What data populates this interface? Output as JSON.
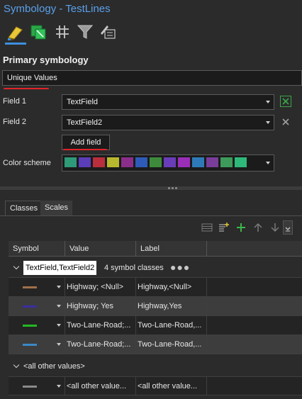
{
  "window": {
    "title": "Symbology - TestLines"
  },
  "toolbar": {
    "icons": [
      "primary-symbology-icon",
      "vary-symbology-icon",
      "label-classes-icon",
      "filter-icon",
      "advanced-symbology-icon"
    ]
  },
  "primary": {
    "heading": "Primary symbology",
    "method": "Unique Values",
    "field1_label": "Field 1",
    "field1_value": "TextField",
    "field2_label": "Field 2",
    "field2_value": "TextField2",
    "add_field_label": "Add field",
    "color_scheme_label": "Color scheme",
    "color_scheme_colors": [
      "#2e9a78",
      "#5b3db8",
      "#b82e3d",
      "#b8b82e",
      "#8a2e8a",
      "#2e5bb8",
      "#3d8a3d",
      "#6a3db8",
      "#9a2eb8",
      "#2e7ab8",
      "#7a3d9a",
      "#3d9a5b",
      "#2eb87a"
    ]
  },
  "tabs": {
    "classes": "Classes",
    "scales": "Scales"
  },
  "grid": {
    "headers": {
      "symbol": "Symbol",
      "value": "Value",
      "label": "Label"
    },
    "group_name": "TextField,TextField2",
    "group_count": "4 symbol classes",
    "rows": [
      {
        "color": "#a0704a",
        "value": "Highway; <Null>",
        "label": "Highway,<Null>"
      },
      {
        "color": "#3a2ea0",
        "value": "Highway; Yes",
        "label": "Highway,Yes"
      },
      {
        "color": "#22b822",
        "value": "Two-Lane-Road;...",
        "label": "Two-Lane-Road,..."
      },
      {
        "color": "#3a8ac8",
        "value": "Two-Lane-Road;...",
        "label": "Two-Lane-Road,..."
      }
    ],
    "other_group": "<all other values>",
    "other_row": {
      "color": "#8a8a8a",
      "value": "<all other value...",
      "label": "<all other value..."
    }
  }
}
